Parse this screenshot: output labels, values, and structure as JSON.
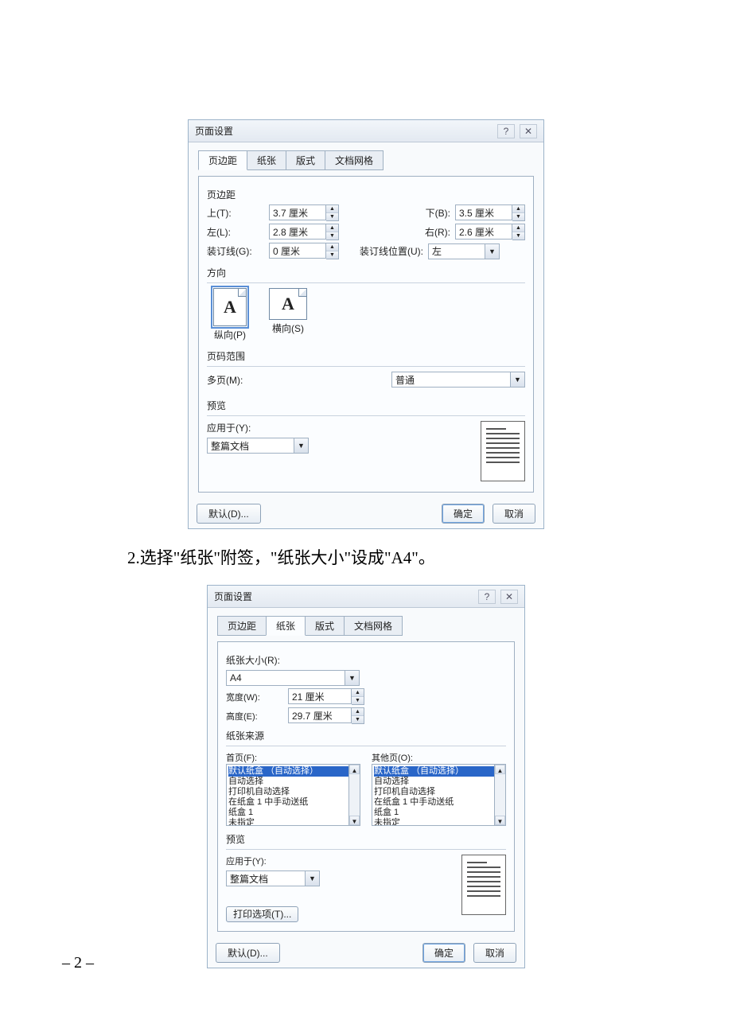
{
  "dlg1": {
    "title": "页面设置",
    "tabs": [
      "页边距",
      "纸张",
      "版式",
      "文档网格"
    ],
    "active_tab_index": 0,
    "margins": {
      "group": "页边距",
      "top_label": "上(T):",
      "top_val": "3.7 厘米",
      "bottom_label": "下(B):",
      "bottom_val": "3.5 厘米",
      "left_label": "左(L):",
      "left_val": "2.8 厘米",
      "right_label": "右(R):",
      "right_val": "2.6 厘米",
      "gutter_label": "装订线(G):",
      "gutter_val": "0 厘米",
      "gutter_pos_label": "装订线位置(U):",
      "gutter_pos_val": "左"
    },
    "orientation": {
      "group": "方向",
      "portrait": "纵向(P)",
      "landscape": "横向(S)"
    },
    "page_range": {
      "group": "页码范围",
      "multi_label": "多页(M):",
      "multi_val": "普通"
    },
    "preview": {
      "group": "预览",
      "apply_label": "应用于(Y):",
      "apply_val": "整篇文档"
    },
    "footer": {
      "default": "默认(D)...",
      "ok": "确定",
      "cancel": "取消"
    }
  },
  "caption": "2.选择\"纸张\"附签，\"纸张大小\"设成\"A4\"。",
  "dlg2": {
    "title": "页面设置",
    "tabs": [
      "页边距",
      "纸张",
      "版式",
      "文档网格"
    ],
    "active_tab_index": 1,
    "paper_size": {
      "group": "纸张大小(R):",
      "size_val": "A4",
      "width_label": "宽度(W):",
      "width_val": "21 厘米",
      "height_label": "高度(E):",
      "height_val": "29.7 厘米"
    },
    "paper_source": {
      "group": "纸张来源",
      "first_label": "首页(F):",
      "other_label": "其他页(O):",
      "items": [
        "默认纸盒 （自动选择）",
        "自动选择",
        "打印机自动选择",
        "在纸盒 1 中手动送纸",
        "纸盒 1",
        "未指定"
      ]
    },
    "preview": {
      "group": "预览",
      "apply_label": "应用于(Y):",
      "apply_val": "整篇文档"
    },
    "print_opts": "打印选项(T)...",
    "footer": {
      "default": "默认(D)...",
      "ok": "确定",
      "cancel": "取消"
    }
  },
  "page_number": "– 2 –"
}
